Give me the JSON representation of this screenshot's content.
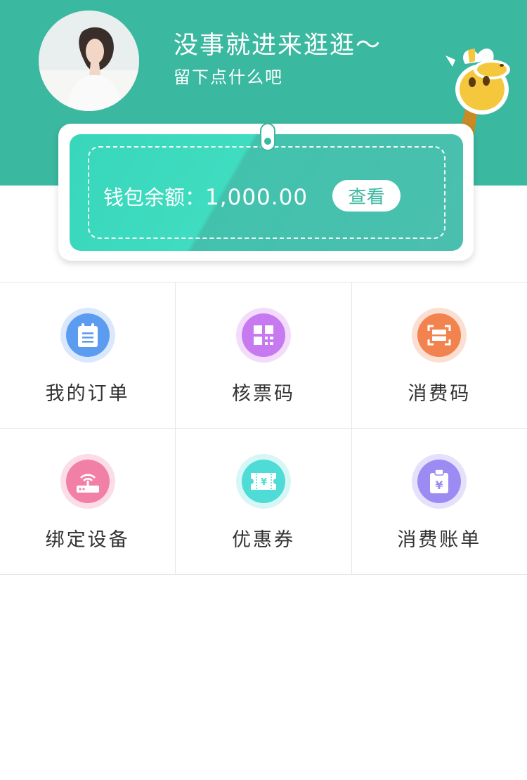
{
  "header": {
    "greeting": "没事就进来逛逛～",
    "subtitle": "留下点什么吧",
    "bg_color": "#3bb8a0"
  },
  "wallet": {
    "label": "钱包余额：",
    "amount": "1,000.00",
    "view_button": "查看"
  },
  "menu": [
    {
      "label": "我的订单",
      "icon": "order-list-icon",
      "color": "#5b9cf0"
    },
    {
      "label": "核票码",
      "icon": "qr-code-icon",
      "color": "#c77af0"
    },
    {
      "label": "消费码",
      "icon": "scan-icon",
      "color": "#f2834f"
    },
    {
      "label": "绑定设备",
      "icon": "router-icon",
      "color": "#f27fa6"
    },
    {
      "label": "优惠券",
      "icon": "coupon-icon",
      "color": "#4fdcd6"
    },
    {
      "label": "消费账单",
      "icon": "bill-icon",
      "color": "#9b8bf2"
    }
  ]
}
